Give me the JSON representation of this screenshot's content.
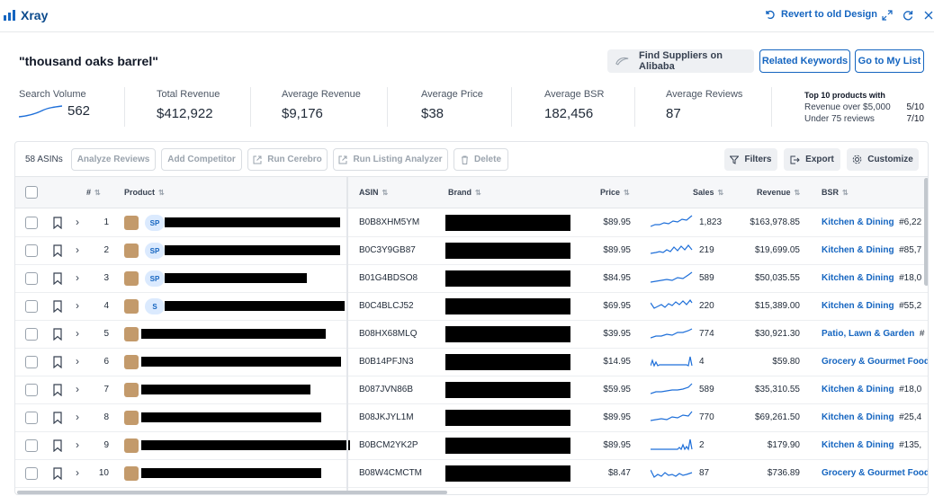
{
  "app": {
    "title": "Xray",
    "revert_label": "Revert to old Design"
  },
  "colors": {
    "accent": "#1565c0",
    "sparkline": "#1e6fd9",
    "sp_badge_bg": "#dbeafe"
  },
  "icons": {
    "logo": "bar-chart-icon",
    "revert": "undo-icon",
    "expand": "expand-icon",
    "refresh": "refresh-icon",
    "close": "close-icon"
  },
  "keyword": "\"thousand oaks barrel\"",
  "actions": {
    "alibaba_label": "Find Suppliers on Alibaba",
    "related_label": "Related Keywords",
    "mylist_label": "Go to My List"
  },
  "metrics": {
    "search_volume": {
      "label": "Search Volume",
      "value": "562"
    },
    "total_revenue": {
      "label": "Total Revenue",
      "value": "$412,922"
    },
    "avg_revenue": {
      "label": "Average Revenue",
      "value": "$9,176"
    },
    "avg_price": {
      "label": "Average Price",
      "value": "$38"
    },
    "avg_bsr": {
      "label": "Average BSR",
      "value": "182,456"
    },
    "avg_reviews": {
      "label": "Average Reviews",
      "value": "87"
    },
    "top10": {
      "title": "Top 10 products with",
      "row1_label": "Revenue over $5,000",
      "row1_value": "5/10",
      "row2_label": "Under 75 reviews",
      "row2_value": "7/10"
    }
  },
  "toolbar": {
    "count": "58 ASINs",
    "analyze": "Analyze Reviews",
    "competitor": "Add Competitor",
    "cerebro": "Run Cerebro",
    "listing": "Run Listing Analyzer",
    "delete": "Delete",
    "filters": "Filters",
    "export": "Export",
    "customize": "Customize"
  },
  "columns": {
    "num": "#",
    "product": "Product",
    "asin": "ASIN",
    "brand": "Brand",
    "price": "Price",
    "sales": "Sales",
    "revenue": "Revenue",
    "bsr": "BSR"
  },
  "rows": [
    {
      "n": "1",
      "sp": "SP",
      "asin": "B0B8XHM5YM",
      "price": "$89.95",
      "sales": "1,823",
      "revenue": "$163,978.85",
      "bsr_cat": "Kitchen & Dining",
      "bsr_rank": "#6,22"
    },
    {
      "n": "2",
      "sp": "SP",
      "asin": "B0C3Y9GB87",
      "price": "$89.95",
      "sales": "219",
      "revenue": "$19,699.05",
      "bsr_cat": "Kitchen & Dining",
      "bsr_rank": "#85,7"
    },
    {
      "n": "3",
      "sp": "SP",
      "asin": "B01G4BDSO8",
      "price": "$84.95",
      "sales": "589",
      "revenue": "$50,035.55",
      "bsr_cat": "Kitchen & Dining",
      "bsr_rank": "#18,0"
    },
    {
      "n": "4",
      "sp": "S",
      "asin": "B0C4BLCJ52",
      "price": "$69.95",
      "sales": "220",
      "revenue": "$15,389.00",
      "bsr_cat": "Kitchen & Dining",
      "bsr_rank": "#55,2"
    },
    {
      "n": "5",
      "sp": "",
      "asin": "B08HX68MLQ",
      "price": "$39.95",
      "sales": "774",
      "revenue": "$30,921.30",
      "bsr_cat": "Patio, Lawn & Garden",
      "bsr_rank": "#"
    },
    {
      "n": "6",
      "sp": "",
      "asin": "B0B14PFJN3",
      "price": "$14.95",
      "sales": "4",
      "revenue": "$59.80",
      "bsr_cat": "Grocery & Gourmet Food",
      "bsr_rank": ""
    },
    {
      "n": "7",
      "sp": "",
      "asin": "B087JVN86B",
      "price": "$59.95",
      "sales": "589",
      "revenue": "$35,310.55",
      "bsr_cat": "Kitchen & Dining",
      "bsr_rank": "#18,0"
    },
    {
      "n": "8",
      "sp": "",
      "asin": "B08JKJYL1M",
      "price": "$89.95",
      "sales": "770",
      "revenue": "$69,261.50",
      "bsr_cat": "Kitchen & Dining",
      "bsr_rank": "#25,4"
    },
    {
      "n": "9",
      "sp": "",
      "asin": "B0BCM2YK2P",
      "price": "$89.95",
      "sales": "2",
      "revenue": "$179.90",
      "bsr_cat": "Kitchen & Dining",
      "bsr_rank": "#135,"
    },
    {
      "n": "10",
      "sp": "",
      "asin": "B08W4CMCTM",
      "price": "$8.47",
      "sales": "87",
      "revenue": "$736.89",
      "bsr_cat": "Grocery & Gourmet Food",
      "bsr_rank": ""
    }
  ]
}
